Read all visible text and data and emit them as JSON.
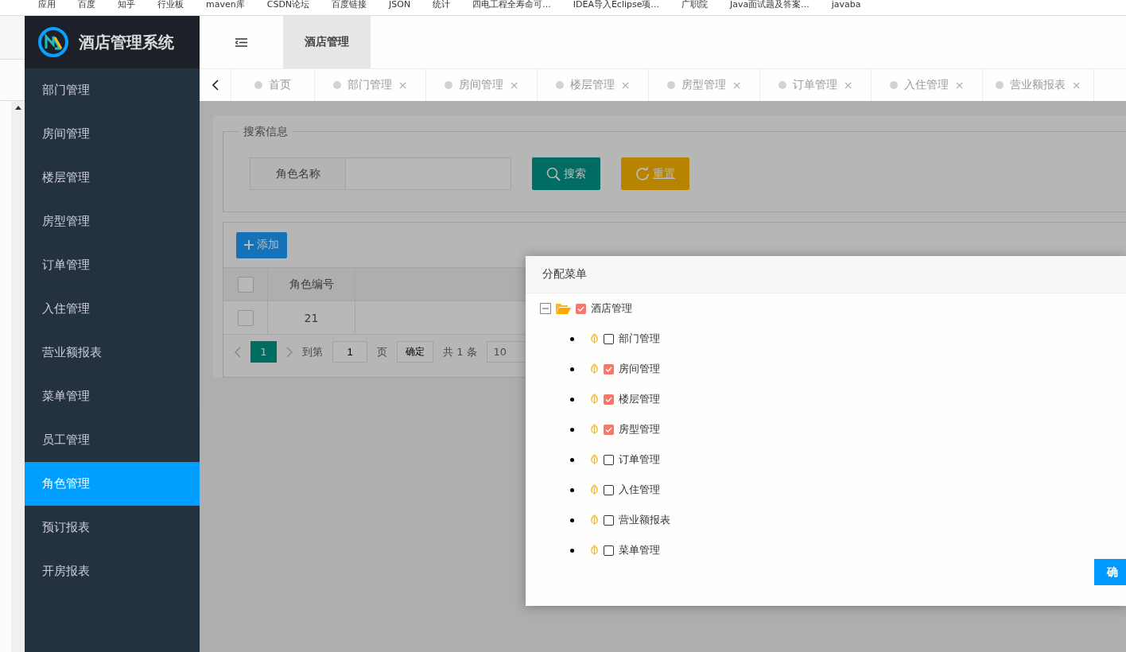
{
  "bookmarks": [
    "应用",
    "百度",
    "知乎",
    "行业板",
    "maven库",
    "CSDN论坛",
    "百度链接",
    "JSON",
    "统计",
    "四电工程全寿命可...",
    "IDEA导入Eclipse项...",
    "广职院",
    "Java面试题及答案...",
    "javaba"
  ],
  "app_title": "酒店管理系统",
  "sidebar": {
    "items": [
      {
        "label": "部门管理",
        "selected": false
      },
      {
        "label": "房间管理",
        "selected": false
      },
      {
        "label": "楼层管理",
        "selected": false
      },
      {
        "label": "房型管理",
        "selected": false
      },
      {
        "label": "订单管理",
        "selected": false
      },
      {
        "label": "入住管理",
        "selected": false
      },
      {
        "label": "营业额报表",
        "selected": false
      },
      {
        "label": "菜单管理",
        "selected": false
      },
      {
        "label": "员工管理",
        "selected": false
      },
      {
        "label": "角色管理",
        "selected": true
      },
      {
        "label": "预订报表",
        "selected": false
      },
      {
        "label": "开房报表",
        "selected": false
      }
    ]
  },
  "header": {
    "nav_items": [
      {
        "label": "酒店管理",
        "selected": true
      }
    ]
  },
  "tabs": [
    {
      "label": "首页"
    },
    {
      "label": "部门管理",
      "close": "×"
    },
    {
      "label": "房间管理",
      "close": "×"
    },
    {
      "label": "楼层管理",
      "close": "×"
    },
    {
      "label": "房型管理",
      "close": "×"
    },
    {
      "label": "订单管理",
      "close": "×"
    },
    {
      "label": "入住管理",
      "close": "×"
    },
    {
      "label": "营业额报表",
      "close": "×"
    }
  ],
  "search": {
    "legend": "搜索信息",
    "field_label": "角色名称",
    "search_button": "搜索",
    "reset_button": "重置"
  },
  "table": {
    "add_button": "添加",
    "columns": [
      "角色编号"
    ],
    "rows": [
      {
        "checked": false,
        "cells": [
          "21"
        ]
      }
    ],
    "header_checked": false
  },
  "pagination": {
    "current": "1",
    "goto_label": "到第",
    "goto_value": "1",
    "page_label": "页",
    "confirm": "确定",
    "total": "共 1 条",
    "page_size": "10"
  },
  "dialog": {
    "title": "分配菜单",
    "confirm": "确",
    "tree": [
      {
        "label": "酒店管理",
        "checked": true,
        "expanded": true,
        "children": [
          {
            "label": "部门管理",
            "checked": false
          },
          {
            "label": "房间管理",
            "checked": true
          },
          {
            "label": "楼层管理",
            "checked": true
          },
          {
            "label": "房型管理",
            "checked": true
          },
          {
            "label": "订单管理",
            "checked": false
          },
          {
            "label": "入住管理",
            "checked": false
          },
          {
            "label": "营业额报表",
            "checked": false
          },
          {
            "label": "菜单管理",
            "checked": false
          }
        ]
      }
    ]
  }
}
